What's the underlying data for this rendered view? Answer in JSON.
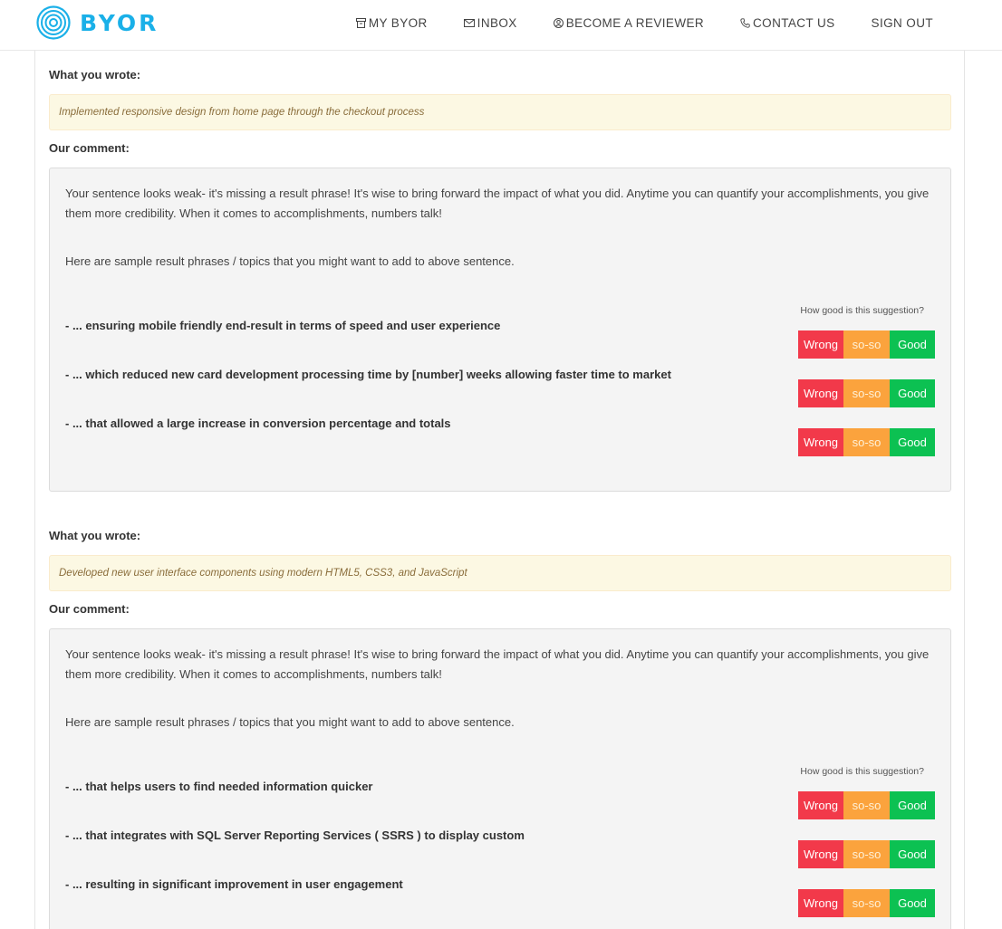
{
  "brand": {
    "name": "BYOR",
    "color": "#1ab0e8"
  },
  "nav": {
    "my_byor": {
      "label": "MY BYOR",
      "icon": "archive-icon"
    },
    "inbox": {
      "label": "INBOX",
      "icon": "envelope-icon"
    },
    "become_reviewer": {
      "label": "BECOME A REVIEWER",
      "icon": "user-circle-icon"
    },
    "contact_us": {
      "label": "CONTACT US",
      "icon": "phone-icon"
    },
    "sign_out": {
      "label": "SIGN OUT"
    }
  },
  "labels": {
    "what_you_wrote": "What you wrote:",
    "our_comment": "Our comment:",
    "how_good": "How good is this suggestion?",
    "wrong": "Wrong",
    "soso": "so-so",
    "good": "Good"
  },
  "colors": {
    "wrong": "#f2394a",
    "soso": "#fba33d",
    "good": "#0cc152",
    "wrote_bg": "#fcf8e3",
    "comment_bg": "#f4f4f4"
  },
  "reviews": [
    {
      "wrote": "Implemented responsive design from home page through the checkout process",
      "comment": "Your sentence looks weak- it's missing a result phrase! It's wise to bring forward the impact of what you did. Anytime you can quantify your accomplishments, you give them more credibility. When it comes to accomplishments, numbers talk!",
      "sample_intro": "Here are sample result phrases / topics that you might want to add to above sentence.",
      "suggestions": [
        "- ... ensuring mobile friendly end-result in terms of speed and user experience",
        "- ... which reduced new card development processing time by [number] weeks allowing faster time to market",
        "- ... that allowed a large increase in conversion percentage and totals"
      ]
    },
    {
      "wrote": "Developed new user interface components using modern HTML5, CSS3, and JavaScript",
      "comment": "Your sentence looks weak- it's missing a result phrase! It's wise to bring forward the impact of what you did. Anytime you can quantify your accomplishments, you give them more credibility. When it comes to accomplishments, numbers talk!",
      "sample_intro": "Here are sample result phrases / topics that you might want to add to above sentence.",
      "suggestions": [
        "- ... that helps users to find needed information quicker",
        "- ... that integrates with SQL Server Reporting Services ( SSRS ) to display custom",
        "- ... resulting in significant improvement in user engagement"
      ]
    }
  ]
}
